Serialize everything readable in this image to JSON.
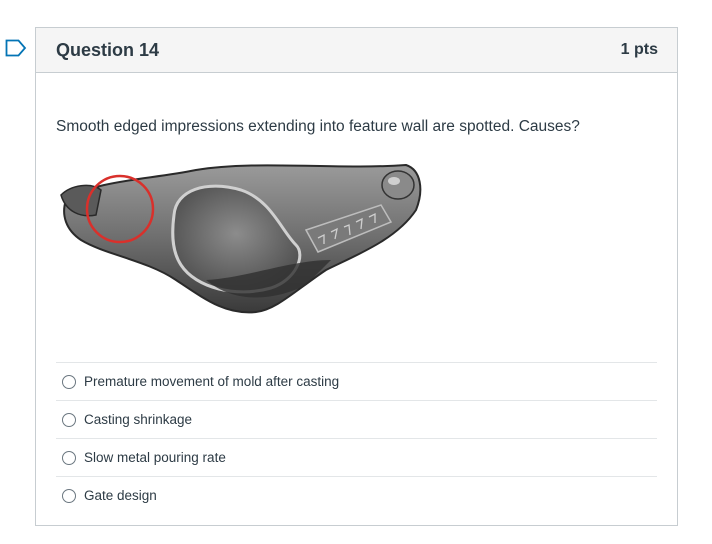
{
  "question": {
    "title": "Question 14",
    "points": "1 pts",
    "text": "Smooth edged impressions extending into feature wall are spotted. Causes?",
    "image_icon": "cast-part-photo",
    "flag_icon": "bookmark-flag-icon"
  },
  "answers": [
    {
      "label": "Premature movement of mold after casting",
      "selected": false
    },
    {
      "label": "Casting shrinkage",
      "selected": false
    },
    {
      "label": "Slow metal pouring rate",
      "selected": false
    },
    {
      "label": "Gate design",
      "selected": false
    }
  ],
  "colors": {
    "accent": "#0374b5",
    "header_bg": "#f5f5f5",
    "border": "#c7cdd1",
    "highlight_circle": "#d9302b"
  }
}
